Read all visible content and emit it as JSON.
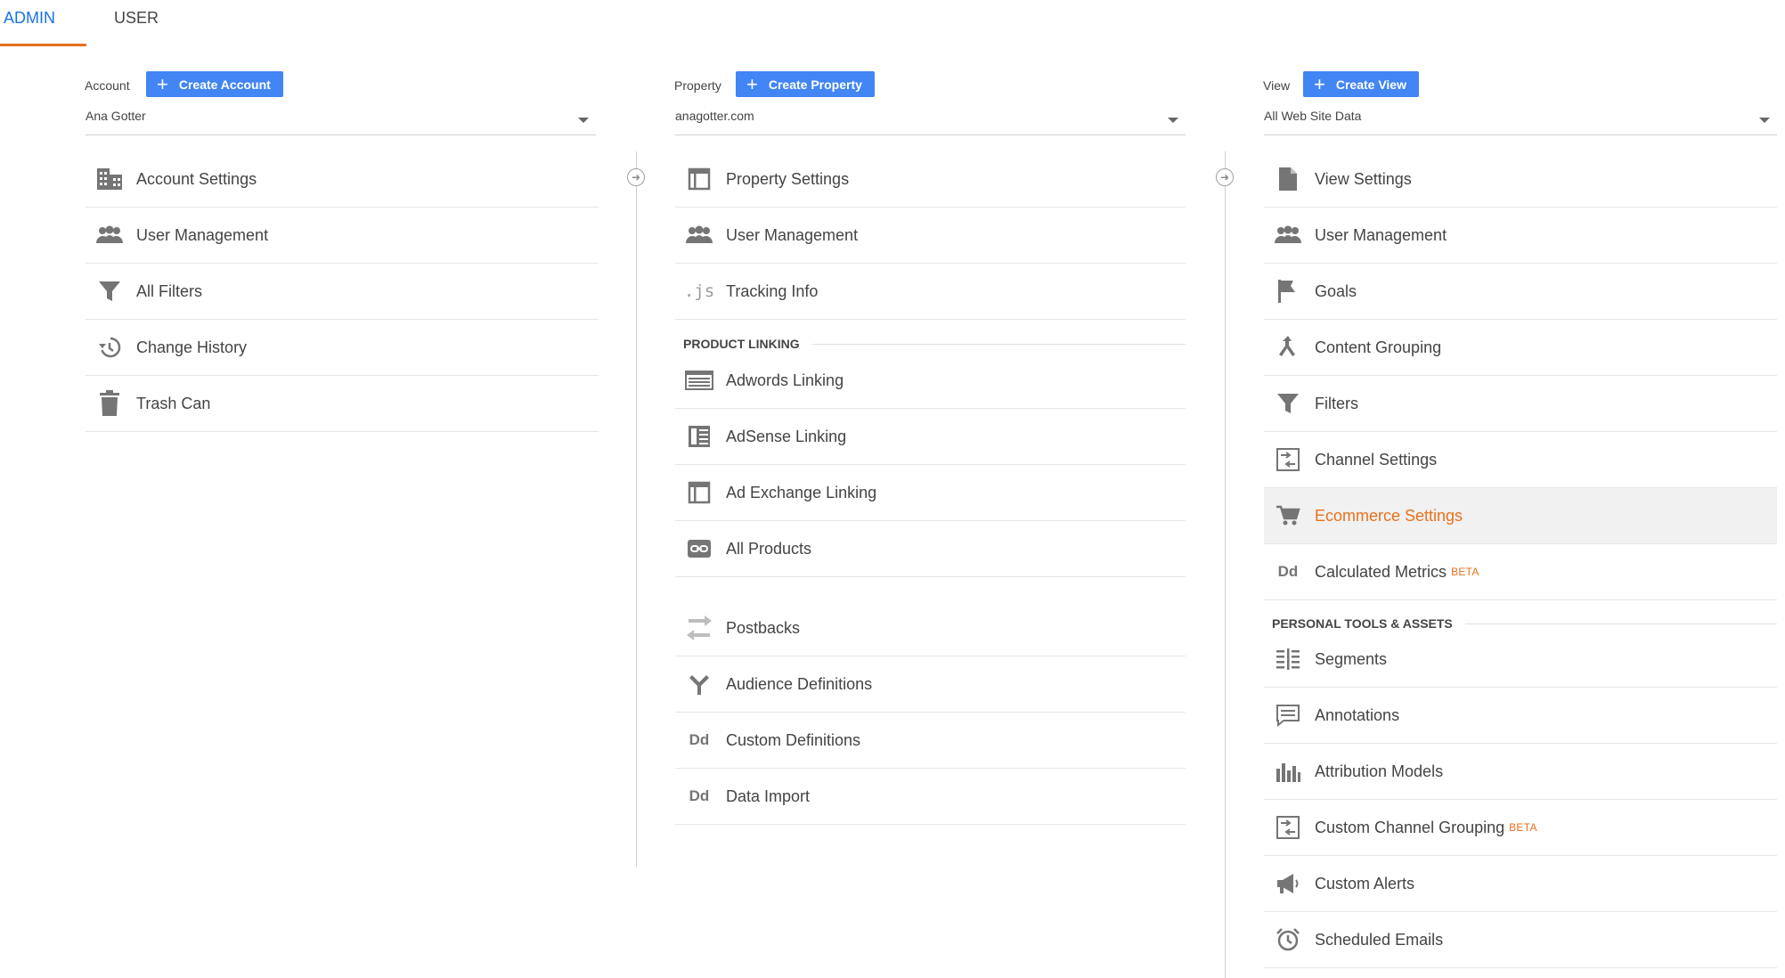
{
  "tabs": {
    "admin": "ADMIN",
    "user": "USER"
  },
  "colors": {
    "accent_blue": "#4285f4",
    "active_tab": "#1a73e8",
    "highlight": "#e8711c",
    "icon_gray": "#757575"
  },
  "account": {
    "label": "Account",
    "create_label": "Create Account",
    "selected": "Ana Gotter",
    "items": [
      {
        "label": "Account Settings",
        "icon": "building-icon"
      },
      {
        "label": "User Management",
        "icon": "people-icon"
      },
      {
        "label": "All Filters",
        "icon": "filter-icon"
      },
      {
        "label": "Change History",
        "icon": "history-icon"
      },
      {
        "label": "Trash Can",
        "icon": "trash-icon"
      }
    ]
  },
  "property": {
    "label": "Property",
    "create_label": "Create Property",
    "selected": "anagotter.com",
    "items": [
      {
        "label": "Property Settings",
        "icon": "window-icon"
      },
      {
        "label": "User Management",
        "icon": "people-icon"
      },
      {
        "label": "Tracking Info",
        "icon": "js-icon",
        "icon_text": ".js"
      }
    ],
    "section_label": "PRODUCT LINKING",
    "linking_items": [
      {
        "label": "Adwords Linking",
        "icon": "adwords-icon"
      },
      {
        "label": "AdSense Linking",
        "icon": "adsense-icon"
      },
      {
        "label": "Ad Exchange Linking",
        "icon": "window-icon"
      },
      {
        "label": "All Products",
        "icon": "link-icon"
      }
    ],
    "extra_items": [
      {
        "label": "Postbacks",
        "icon": "postbacks-icon"
      },
      {
        "label": "Audience Definitions",
        "icon": "audience-icon"
      },
      {
        "label": "Custom Definitions",
        "icon": "dd-icon",
        "icon_text": "Dd"
      },
      {
        "label": "Data Import",
        "icon": "dd-icon",
        "icon_text": "Dd"
      }
    ]
  },
  "view": {
    "label": "View",
    "create_label": "Create View",
    "selected": "All Web Site Data",
    "items": [
      {
        "label": "View Settings",
        "icon": "document-icon"
      },
      {
        "label": "User Management",
        "icon": "people-icon"
      },
      {
        "label": "Goals",
        "icon": "flag-icon"
      },
      {
        "label": "Content Grouping",
        "icon": "content-grouping-icon"
      },
      {
        "label": "Filters",
        "icon": "filter-icon"
      },
      {
        "label": "Channel Settings",
        "icon": "channel-icon"
      },
      {
        "label": "Ecommerce Settings",
        "icon": "cart-icon",
        "active": true
      },
      {
        "label": "Calculated Metrics",
        "icon": "dd-icon",
        "icon_text": "Dd",
        "badge": "BETA"
      }
    ],
    "section_label": "PERSONAL TOOLS & ASSETS",
    "tool_items": [
      {
        "label": "Segments",
        "icon": "segments-icon"
      },
      {
        "label": "Annotations",
        "icon": "annotation-icon"
      },
      {
        "label": "Attribution Models",
        "icon": "bar-chart-icon"
      },
      {
        "label": "Custom Channel Grouping",
        "icon": "channel-icon",
        "badge": "BETA"
      },
      {
        "label": "Custom Alerts",
        "icon": "megaphone-icon"
      },
      {
        "label": "Scheduled Emails",
        "icon": "alarm-icon"
      }
    ]
  }
}
